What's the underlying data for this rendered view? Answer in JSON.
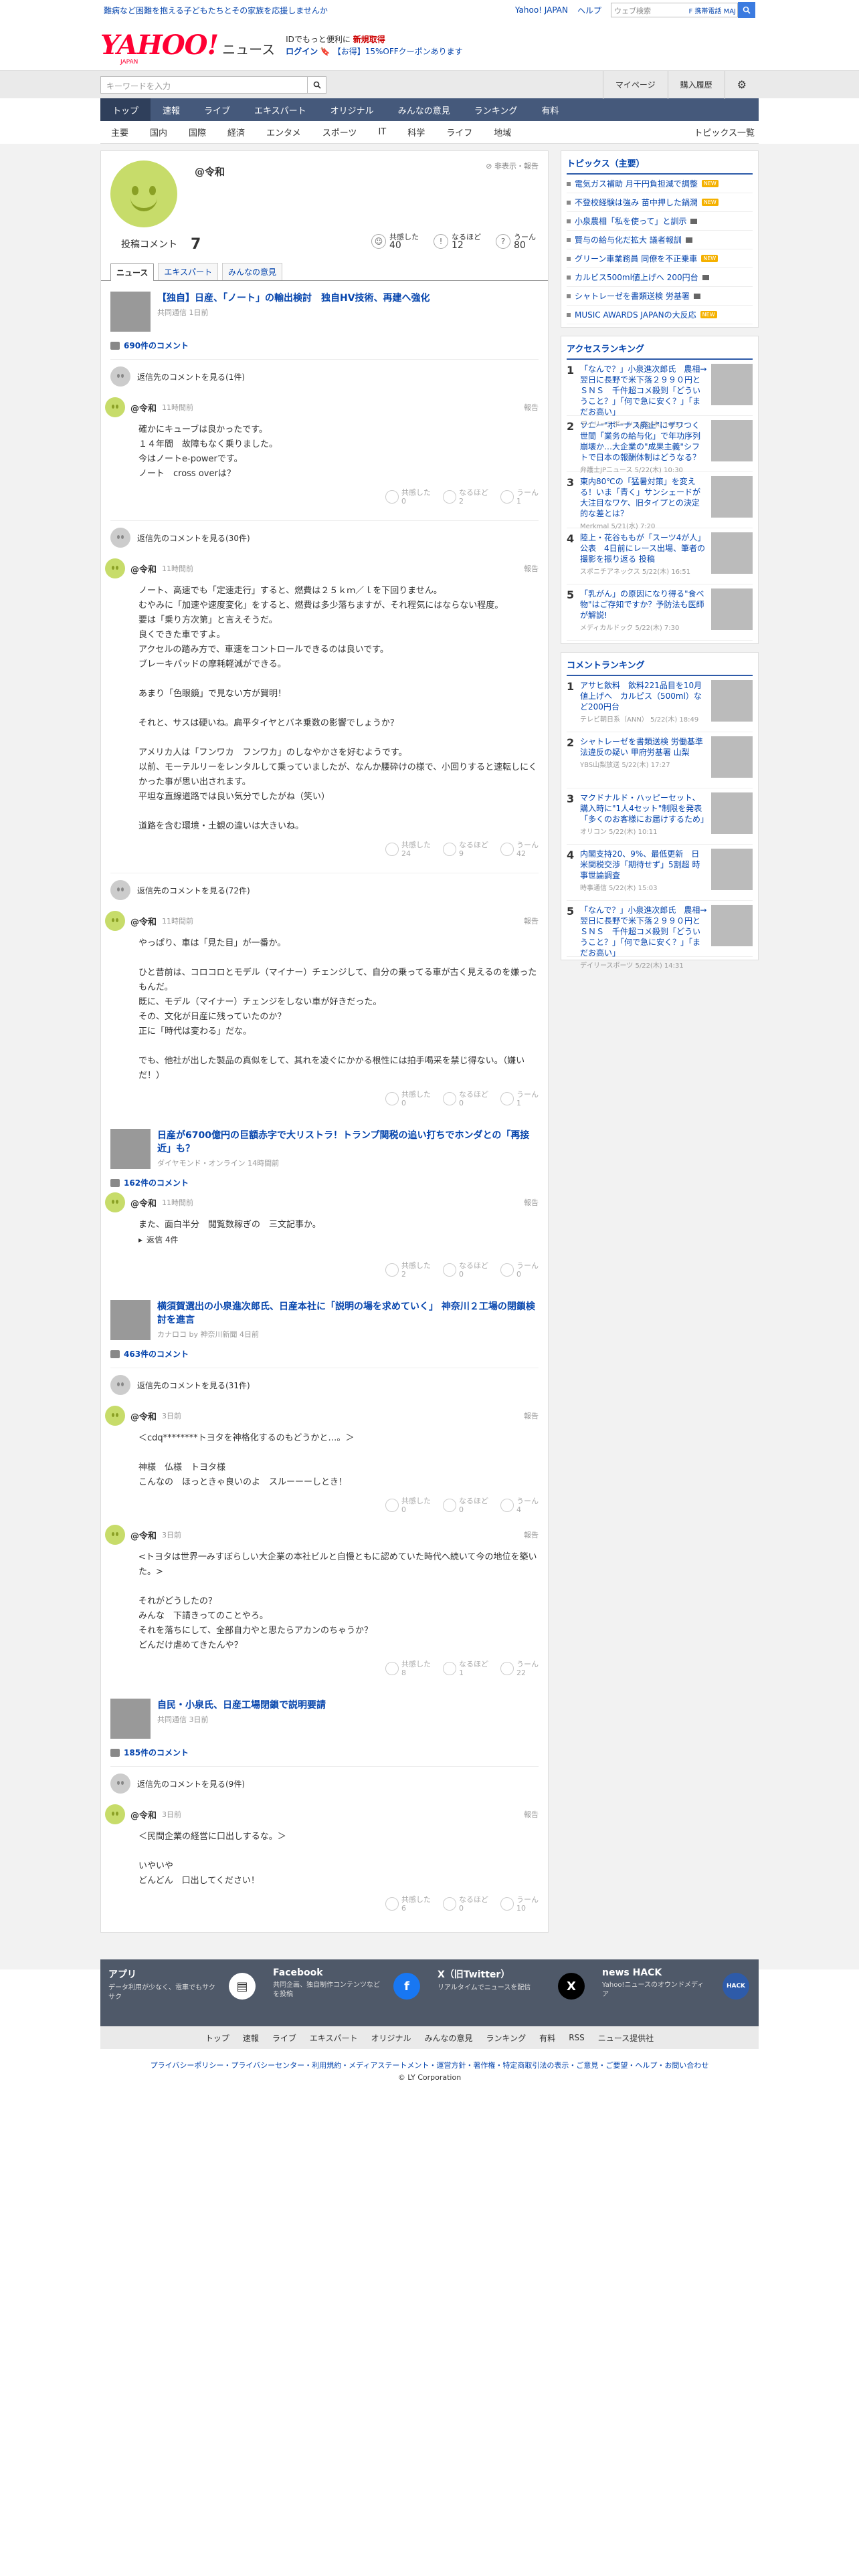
{
  "top": {
    "ad": "難病など困難を抱える子どもたちとその家族を応援しませんか",
    "links": [
      "Yahoo! JAPAN",
      "ヘルプ"
    ],
    "search_placeholder": "ウェブ検索",
    "search_tag": "F 携帯電話 MAJ"
  },
  "header": {
    "logo": "YAHOO!",
    "logo_sub": "JAPAN",
    "service": "ニュース",
    "promo_line1a": "IDでもっと便利に",
    "promo_line1b": "新規取得",
    "promo_line2a": "ログイン",
    "promo_line2b": "【お得】15%OFFクーポンあります"
  },
  "subbar": {
    "search_placeholder": "キーワードを入力",
    "mypage": "マイページ",
    "history": "購入履歴"
  },
  "gnav": [
    "トップ",
    "速報",
    "ライブ",
    "エキスパート",
    "オリジナル",
    "みんなの意見",
    "ランキング",
    "有料"
  ],
  "cnav": [
    "主要",
    "国内",
    "国際",
    "経済",
    "エンタメ",
    "スポーツ",
    "IT",
    "科学",
    "ライフ",
    "地域"
  ],
  "cnav_more": "トピックス一覧",
  "profile": {
    "name": "@令和",
    "hide": "非表示・報告",
    "posts_label": "投稿コメント",
    "posts_count": "7",
    "r1_label": "共感した",
    "r1_val": "40",
    "r2_label": "なるほど",
    "r2_val": "12",
    "r3_label": "うーん",
    "r3_val": "80"
  },
  "tabs": [
    "ニュース",
    "エキスパート",
    "みんなの意見"
  ],
  "articles": [
    {
      "title": "【独自】日産、「ノート」の輸出検討　独自HV技術、再建へ強化",
      "meta": "共同通信 1日前",
      "count": "690件のコメント",
      "threads": [
        {
          "parent": "返信先のコメントを見る(1件)",
          "name": "@令和",
          "time": "11時間前",
          "report": "報告",
          "body": "確かにキューブは良かったです。\n１４年間　故障もなく乗りました。\n今はノートe-powerです。\nノート　cross overは？",
          "a": "0",
          "b": "2",
          "c": "1"
        },
        {
          "parent": "返信先のコメントを見る(30件)",
          "name": "@令和",
          "time": "11時間前",
          "report": "報告",
          "body": "ノート、高速でも「定速走行」すると、燃費は２５ｋｍ／ｌを下回りません。\nむやみに「加速や速度変化」をすると、燃費は多少落ちますが、それ程気にはならない程度。\n要は「乗り方次第」と言えそうだ。\n良くできた車ですよ。\nアクセルの踏み方で、車速をコントロールできるのは良いです。\nブレーキパッドの摩耗軽減ができる。\n\nあまり「色眼鏡」で見ない方が賢明！\n\nそれと、サスは硬いね。扁平タイヤとバネ乗数の影響でしょうか？\n\nアメリカ人は「フンワカ　フンワカ」のしなやかさを好むようです。\n以前、モーテルリーをレンタルして乗っていましたが、なんか腰砕けの様で、小回りすると速転しにくかった事が思い出されます。\n平坦な直線道路では良い気分でしたがね（笑い）\n\n道路を含む環境・土観の違いは大きいね。",
          "a": "24",
          "b": "9",
          "c": "42"
        },
        {
          "parent": "返信先のコメントを見る(72件)",
          "name": "@令和",
          "time": "11時間前",
          "report": "報告",
          "body": "やっぱり、車は「見た目」が一番か。\n\nひと昔前は、コロコロとモデル（マイナー）チェンジして、自分の乗ってる車が古く見えるのを嫌ったもんだ。\n既に、モデル（マイナー）チェンジをしない車が好きだった。\nその、文化が日産に残っていたのか？\n正に「時代は変わる」だな。\n\nでも、他社が出した製品の真似をして、其れを凌ぐにかかる根性には拍手喝采を禁じ得ない。（嫌いだ！）",
          "a": "0",
          "b": "0",
          "c": "1"
        }
      ]
    },
    {
      "title": "日産が6700億円の巨額赤字で大リストラ！トランプ関税の追い打ちでホンダとの「再接近」も？",
      "meta": "ダイヤモンド・オンライン 14時間前",
      "count": "162件のコメント",
      "threads": [
        {
          "parent": "",
          "name": "@令和",
          "time": "11時間前",
          "report": "報告",
          "body": "また、面白半分　閲覧数稼ぎの　三文記事か。",
          "a": "2",
          "b": "0",
          "c": "0",
          "replies": "返信 4件"
        }
      ]
    },
    {
      "title": "横須賀選出の小泉進次郎氏、日産本社に「説明の場を求めていく」 神奈川２工場の閉鎖検討を進言",
      "meta": "カナロコ by 神奈川新聞 4日前",
      "count": "463件のコメント",
      "threads": [
        {
          "parent": "返信先のコメントを見る(31件)",
          "name": "@令和",
          "time": "3日前",
          "report": "報告",
          "body": "＜cdq********トヨタを神格化するのもどうかと…。＞\n\n神様　仏様　トヨタ様\nこんなの　ほっときゃ良いのよ　スルーーーしとき！",
          "a": "0",
          "b": "0",
          "c": "4"
        },
        {
          "parent": "",
          "name": "@令和",
          "time": "3日前",
          "report": "報告",
          "body": "<トヨタは世界一みすぼらしい大企業の本社ビルと自慢ともに認めていた時代へ続いて今の地位を築いた。>\n\nそれがどうしたの？\nみんな　下請きってのことやろ。\nそれを落ちにして、全部自力やと思たらアカンのちゃうか？\nどんだけ虐めてきたんや？",
          "a": "8",
          "b": "1",
          "c": "22"
        }
      ]
    },
    {
      "title": "自民・小泉氏、日産工場閉鎖で説明要請",
      "meta": "共同通信 3日前",
      "count": "185件のコメント",
      "threads": [
        {
          "parent": "返信先のコメントを見る(9件)",
          "name": "@令和",
          "time": "3日前",
          "report": "報告",
          "body": "＜民間企業の経営に口出しするな。＞\n\nいやいや\nどんどん　口出してください！",
          "a": "6",
          "b": "0",
          "c": "10"
        }
      ]
    }
  ],
  "reaction_labels": [
    "共感した",
    "なるほど",
    "うーん"
  ],
  "sidebar": {
    "topics_title": "トピックス（主要）",
    "topics": [
      {
        "t": "電気ガス補助 月干円負担減で調整",
        "badge": "NEW"
      },
      {
        "t": "不登校経験は強み 苗中押した鍋潤",
        "badge": "NEW"
      },
      {
        "t": "小泉農相「私を使って」と訓示",
        "badge": ""
      },
      {
        "t": "賢与の給与化だ拡大 議者報訓",
        "badge": ""
      },
      {
        "t": "グリーン車業務員 同僚を不正乗車",
        "badge": "NEW"
      },
      {
        "t": "カルビス500ml値上げへ 200円台",
        "badge": ""
      },
      {
        "t": "シャトレーゼを書類送検 労基署",
        "badge": ""
      },
      {
        "t": "MUSIC AWARDS JAPANの大反応",
        "badge": "NEW"
      }
    ],
    "access_title": "アクセスランキング",
    "access": [
      {
        "n": "1",
        "t": "「なんで？」小泉進次郎氏　農相→翌日に長野で米下落２９９０円とＳＮＳ　千件超コメ殺到「どういうこと？」「何で急に安く？」「まだお高い」",
        "m": "デイリースポーツ 5/22(木) 14:31"
      },
      {
        "n": "2",
        "t": "ソニー\"ボーナス廃止\"にザワつく世間「業务の給与化」で年功序列崩壊か…大企業の\"成果主義\"シフトで日本の報酬体制はどうなる？",
        "m": "弁護士JPニュース 5/22(木) 10:30"
      },
      {
        "n": "3",
        "t": "東内80℃の「猛暑対策」を変える！いま「青く」サンシェードが大注目なワケ、旧タイプとの決定的な差とは？",
        "m": "Merkmal 5/21(水) 7:20"
      },
      {
        "n": "4",
        "t": "陸上・花谷ももが「スーツ4が人」公表　4日前にレース出場、筆者の撮影を振り返る 投稿",
        "m": "スポニチアネックス 5/22(木) 16:51"
      },
      {
        "n": "5",
        "t": "「乳がん」の原因になり得る\"食べ物\"はご存知ですか？予防法も医師が解説!",
        "m": "メディカルドック 5/22(木) 7:30"
      }
    ],
    "comment_title": "コメントランキング",
    "comment": [
      {
        "n": "1",
        "t": "アサヒ飲料　飲料221品目を10月値上げへ　カルピス（500ml）など200円台",
        "m": "テレビ朝日系（ANN） 5/22(木) 18:49"
      },
      {
        "n": "2",
        "t": "シャトレーゼを書類送検 労働基準法違反の疑い 甲府労基署 山梨",
        "m": "YBS山梨放送 5/22(木) 17:27"
      },
      {
        "n": "3",
        "t": "マクドナルド・ハッピーセット、購入時に\"1人4セット\"制限を発表「多くのお客様にお届けするため」",
        "m": "オリコン 5/22(木) 10:11"
      },
      {
        "n": "4",
        "t": "内閣支持20、9%、最低更新　日米関税交渉「期待せず」5割超 時事世論調査",
        "m": "時事通信 5/22(木) 15:03"
      },
      {
        "n": "5",
        "t": "「なんで？」小泉進次郎氏　農相→翌日に長野で米下落２９９０円とＳＮＳ　千件超コメ殺到「どういうこと？」「何で急に安く？」「まだお高い」",
        "m": "デイリースポーツ 5/22(木) 14:31"
      }
    ]
  },
  "footer": {
    "cols": [
      {
        "h": "アプリ",
        "d": "データ利用が少なく、電車でもサクサク"
      },
      {
        "h": "Facebook",
        "d": "共同企画、独自制作コンテンツなどを投稿"
      },
      {
        "h": "X（旧Twitter）",
        "d": "リアルタイムでニュースを配信"
      },
      {
        "h": "news HACK",
        "d": "Yahoo!ニュースのオウンドメディア"
      }
    ],
    "nav": [
      "トップ",
      "速報",
      "ライブ",
      "エキスパート",
      "オリジナル",
      "みんなの意見",
      "ランキング",
      "有料",
      "RSS",
      "ニュース提供社"
    ],
    "links": "プライバシーポリシー・プライバシーセンター・利用規約・メディアステートメント・運営方針・著作権・特定商取引法の表示・ご意見・ご要望・ヘルプ・お問い合わせ",
    "copy": "© LY Corporation"
  }
}
